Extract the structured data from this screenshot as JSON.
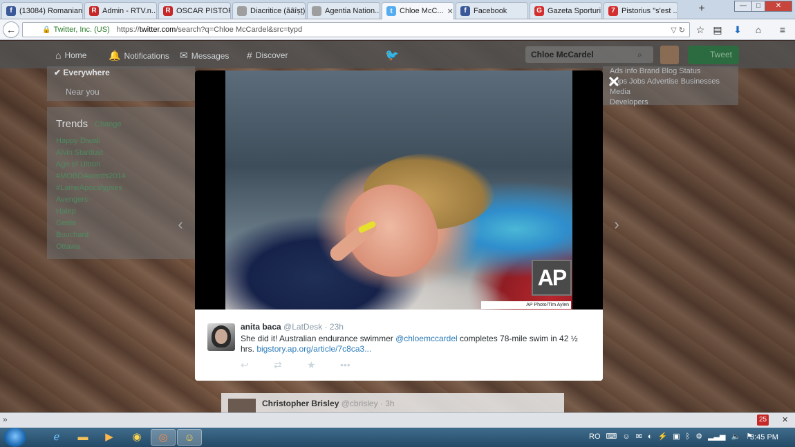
{
  "browser": {
    "tabs": [
      {
        "label": "(13084) Romanian...",
        "favicon": "facebook-icon",
        "color": "#3b5998",
        "glyph": "f"
      },
      {
        "label": "Admin - RTV.n...",
        "favicon": "rtv-icon",
        "color": "#c62828",
        "glyph": "R"
      },
      {
        "label": "OSCAR PISTOR...",
        "favicon": "rtv-icon",
        "color": "#c62828",
        "glyph": "R"
      },
      {
        "label": "Diacritice (ăâîșț) - tr...",
        "favicon": "page-icon",
        "color": "#9e9e9e",
        "glyph": ""
      },
      {
        "label": "Agentia Nation...",
        "favicon": "page-icon",
        "color": "#9e9e9e",
        "glyph": ""
      },
      {
        "label": "Chloe McC...",
        "favicon": "twitter-icon",
        "color": "#55acee",
        "glyph": "t"
      },
      {
        "label": "Facebook",
        "favicon": "facebook-icon",
        "color": "#3b5998",
        "glyph": "f"
      },
      {
        "label": "Gazeta Sporturi...",
        "favicon": "gsp-icon",
        "color": "#d32f2f",
        "glyph": "G"
      },
      {
        "label": "Pistorius \"s'est ...",
        "favicon": "seven-icon",
        "color": "#d32f2f",
        "glyph": "7"
      }
    ],
    "new_tab": "+",
    "window_controls": {
      "minimize": "—",
      "maximize": "□",
      "close": "✕"
    },
    "url": {
      "identity": "Twitter, Inc. (US)",
      "scheme": "https://",
      "domain": "twitter.com",
      "rest": "/search?q=Chloe McCardel&src=typd"
    }
  },
  "twitter": {
    "nav": {
      "home": "Home",
      "notifications": "Notifications",
      "messages": "Messages",
      "discover": "Discover"
    },
    "search_value": "Chloe McCardel",
    "tweet_button": "Tweet",
    "location": {
      "everywhere": "Everywhere",
      "near_you": "Near you"
    },
    "trends": {
      "title": "Trends",
      "change": "Change",
      "items": [
        "Happy Diwali",
        "Alvin Stardust",
        "Age of Ultron",
        "#MOBOAwards2014",
        "#LameApocalypses",
        "Avengers",
        "Halep",
        "Genie",
        "Bouchard",
        "Ottawa"
      ]
    },
    "footer_links": "Ads info  Brand  Blog  Status\nApps  Jobs  Advertise  Businesses  Media\nDevelopers",
    "background_tweet": {
      "name": "Christopher Brisley",
      "handle": "@cbrisley · 3h"
    }
  },
  "modal": {
    "close": "✕",
    "prev": "‹",
    "next": "›",
    "photo_logo": "AP",
    "photo_credit": "AP Photo/Tim Aylen",
    "tweet": {
      "name": "anita baca",
      "handle": "@LatDesk · 23h",
      "text_before": "She did it! Australian endurance swimmer ",
      "mention": "@chloemccardel",
      "text_after": " completes 78-mile swim in 42 ½ hrs. ",
      "link": "bigstory.ap.org/article/7c8ca3...",
      "actions": [
        "reply-icon",
        "retweet-icon",
        "favorite-icon",
        "more-icon"
      ]
    }
  },
  "addon_bar": {
    "chevron": "»",
    "badge": "25",
    "close": "✕"
  },
  "taskbar": {
    "language": "RO",
    "clock": "3:45 PM"
  }
}
